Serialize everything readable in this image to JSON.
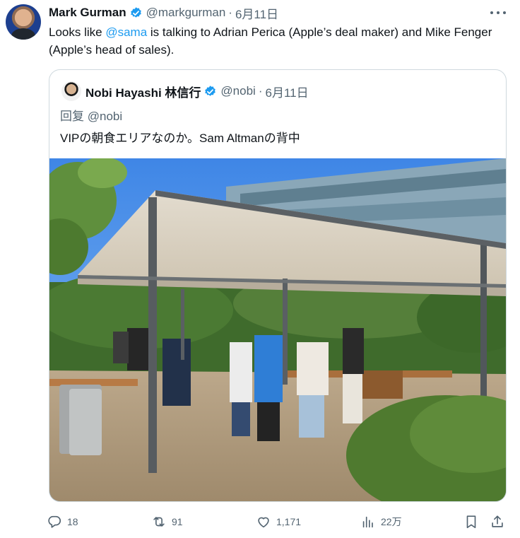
{
  "author": {
    "display_name": "Mark Gurman",
    "handle": "@markgurman",
    "separator": "·",
    "date": "6月11日",
    "verified": true
  },
  "tweet": {
    "text_before": "Looks like ",
    "mention": "@sama",
    "text_after": " is talking to Adrian Perica (Apple’s deal maker) and Mike Fenger (Apple’s head of sales)."
  },
  "quote": {
    "display_name": "Nobi Hayashi 林信行",
    "handle": "@nobi",
    "separator": "·",
    "date": "6月11日",
    "reply_prefix": "回复",
    "reply_to": "@nobi",
    "text": "VIPの朝食エリアなのか。Sam Altmanの背中"
  },
  "actions": {
    "replies": "18",
    "reposts": "91",
    "likes": "1,171",
    "views": "22万"
  },
  "colors": {
    "accent": "#1d9bf0",
    "secondary_text": "#536471",
    "border": "#cfd9de",
    "primary_text": "#0f1419"
  },
  "icons": [
    "verified-badge-icon",
    "more-icon",
    "reply-icon",
    "repost-icon",
    "like-icon",
    "views-icon",
    "bookmark-icon",
    "share-icon"
  ]
}
